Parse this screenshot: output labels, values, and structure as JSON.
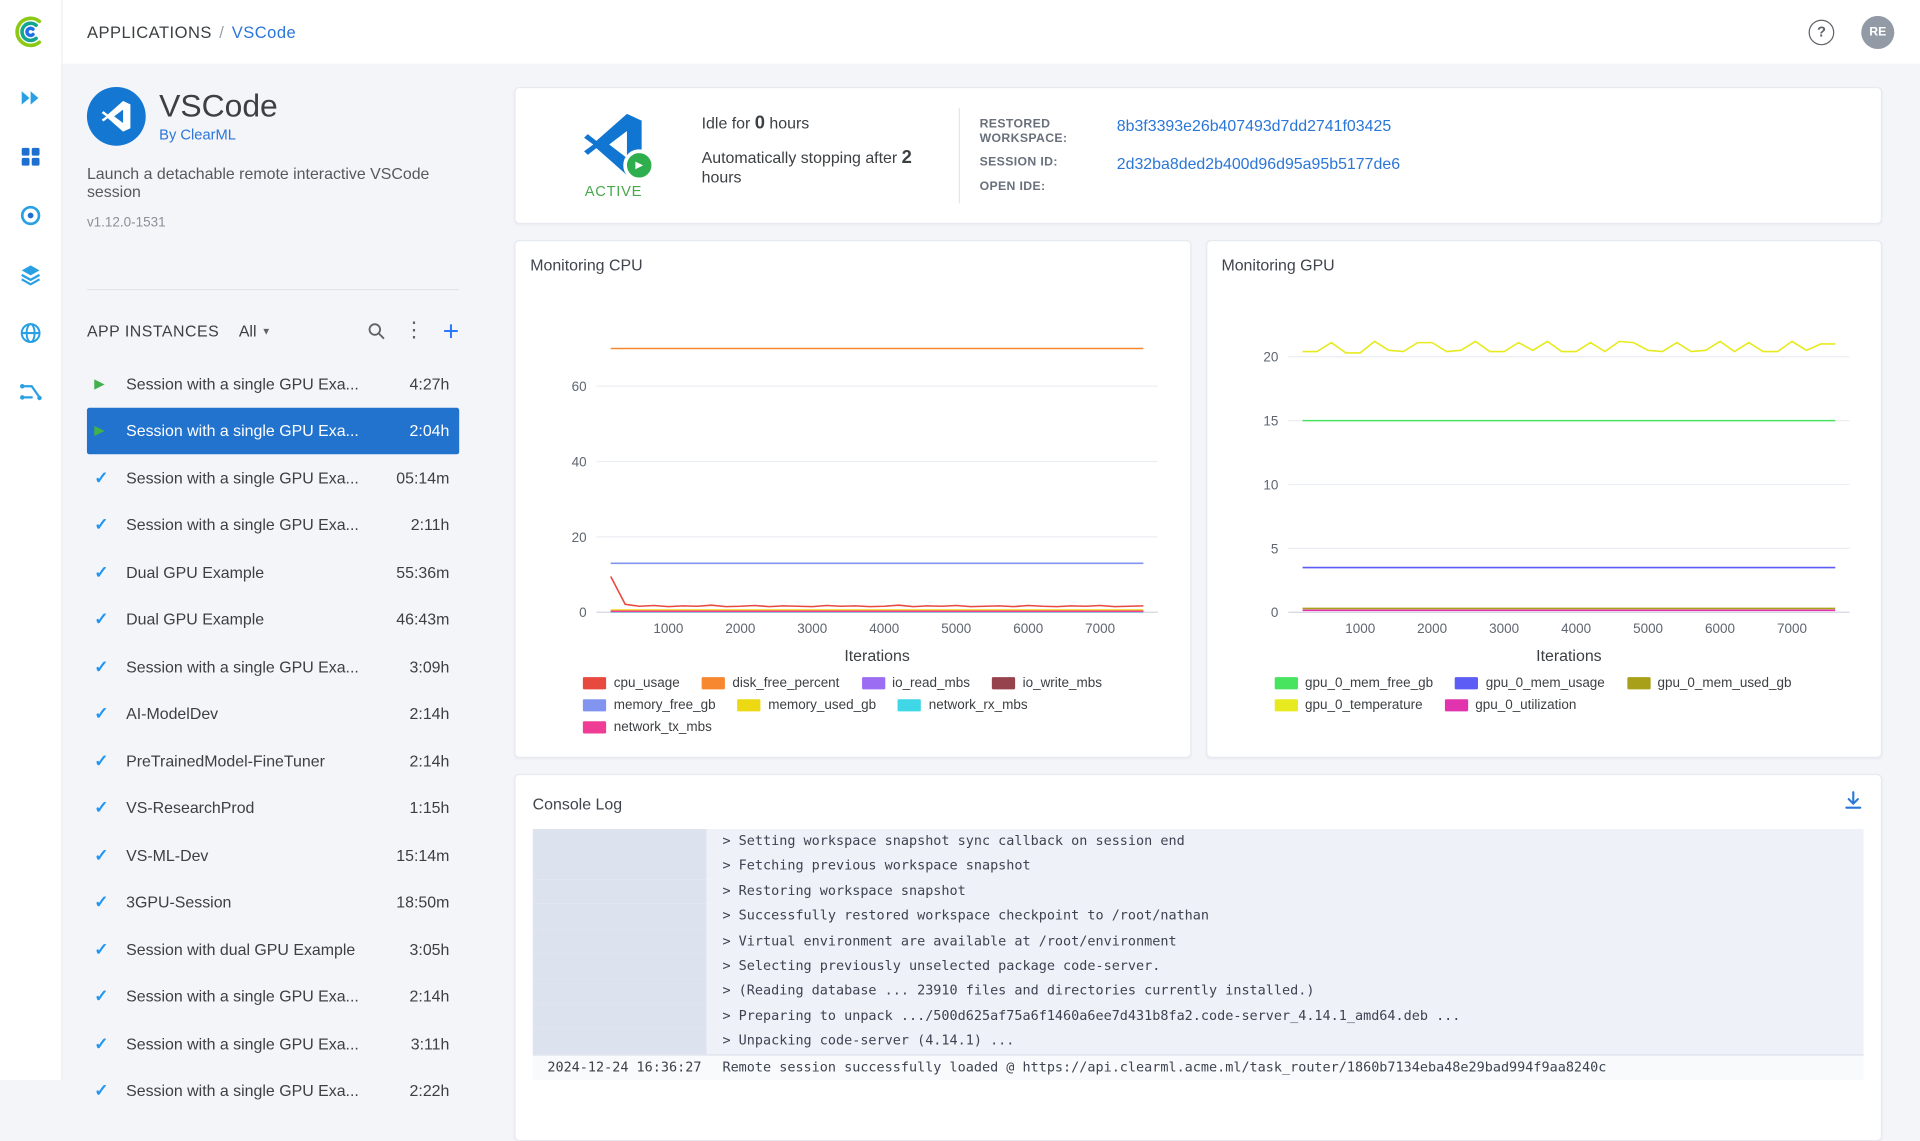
{
  "colors": {
    "link_blue": "#2a76d9",
    "selected_row_blue": "#2173ce",
    "active_green": "#49a84c",
    "check_blue": "#2196f3",
    "play_green": "#43b14b"
  },
  "topbar": {
    "breadcrumb": {
      "section": "APPLICATIONS",
      "separator": "/",
      "current": "VSCode"
    },
    "help_glyph": "?",
    "avatar_initials": "RE"
  },
  "rail": {
    "items": [
      "workers-queues",
      "dashboard",
      "applications",
      "datasets",
      "reports",
      "pipelines"
    ]
  },
  "app_panel": {
    "title": "VSCode",
    "byline": "By ClearML",
    "description": "Launch a detachable remote interactive VSCode session",
    "version": "v1.12.0-1531",
    "instances": {
      "header": "APP INSTANCES",
      "filter": "All",
      "rows": [
        {
          "status": "running",
          "name": "Session with a single GPU Exa...",
          "duration": "4:27h",
          "selected": false
        },
        {
          "status": "running",
          "name": "Session with a single GPU Exa...",
          "duration": "2:04h",
          "selected": true
        },
        {
          "status": "completed",
          "name": "Session with a single GPU Exa...",
          "duration": "05:14m",
          "selected": false
        },
        {
          "status": "completed",
          "name": "Session with a single GPU Exa...",
          "duration": "2:11h",
          "selected": false
        },
        {
          "status": "completed",
          "name": "Dual GPU Example",
          "duration": "55:36m",
          "selected": false
        },
        {
          "status": "completed",
          "name": "Dual GPU Example",
          "duration": "46:43m",
          "selected": false
        },
        {
          "status": "completed",
          "name": "Session with a single GPU Exa...",
          "duration": "3:09h",
          "selected": false
        },
        {
          "status": "completed",
          "name": "AI-ModelDev",
          "duration": "2:14h",
          "selected": false
        },
        {
          "status": "completed",
          "name": "PreTrainedModel-FineTuner",
          "duration": "2:14h",
          "selected": false
        },
        {
          "status": "completed",
          "name": "VS-ResearchProd",
          "duration": "1:15h",
          "selected": false
        },
        {
          "status": "completed",
          "name": "VS-ML-Dev",
          "duration": "15:14m",
          "selected": false
        },
        {
          "status": "completed",
          "name": "3GPU-Session",
          "duration": "18:50m",
          "selected": false
        },
        {
          "status": "completed",
          "name": "Session with dual GPU Example",
          "duration": "3:05h",
          "selected": false
        },
        {
          "status": "completed",
          "name": "Session with a single GPU Exa...",
          "duration": "2:14h",
          "selected": false
        },
        {
          "status": "completed",
          "name": "Session with a single GPU Exa...",
          "duration": "3:11h",
          "selected": false
        },
        {
          "status": "completed",
          "name": "Session with a single GPU Exa...",
          "duration": "2:22h",
          "selected": false
        }
      ]
    }
  },
  "status_card": {
    "status_label": "ACTIVE",
    "idle": {
      "prefix": "Idle for",
      "value": "0",
      "suffix": "hours"
    },
    "autostop": {
      "prefix": "Automatically stopping after",
      "value": "2",
      "suffix": "hours"
    },
    "fields": [
      {
        "label": "RESTORED WORKSPACE:",
        "value": "8b3f3393e26b407493d7dd2741f03425"
      },
      {
        "label": "SESSION ID:",
        "value": "2d32ba8ded2b400d96d95a95b5177de6"
      },
      {
        "label": "OPEN IDE:",
        "value": ""
      }
    ]
  },
  "chart_data": [
    {
      "type": "line",
      "title": "Monitoring CPU",
      "xlabel": "Iterations",
      "ylabel": "",
      "xlim": [
        0,
        7800
      ],
      "ylim": [
        0,
        78
      ],
      "xticks": [
        1000,
        2000,
        3000,
        4000,
        5000,
        6000,
        7000
      ],
      "yticks": [
        0,
        20,
        40,
        60
      ],
      "grid": true,
      "legend_position": "bottom",
      "x": [
        200,
        400,
        600,
        800,
        1000,
        1200,
        1400,
        1600,
        1800,
        2000,
        2200,
        2400,
        2600,
        2800,
        3000,
        3200,
        3400,
        3600,
        3800,
        4000,
        4200,
        4400,
        4600,
        4800,
        5000,
        5200,
        5400,
        5600,
        5800,
        6000,
        6200,
        6400,
        6600,
        6800,
        7000,
        7200,
        7400,
        7600
      ],
      "series": [
        {
          "name": "cpu_usage",
          "color": "#e8493e",
          "values": [
            9.5,
            2.1,
            1.6,
            1.8,
            1.5,
            1.7,
            1.6,
            1.9,
            1.5,
            1.6,
            1.8,
            1.5,
            1.7,
            1.6,
            1.5,
            1.8,
            1.6,
            1.7,
            1.5,
            1.6,
            1.9,
            1.5,
            1.7,
            1.6,
            1.8,
            1.5,
            1.6,
            1.7,
            1.5,
            1.8,
            1.6,
            1.5,
            1.7,
            1.6,
            1.8,
            1.5,
            1.6,
            1.7
          ]
        },
        {
          "name": "disk_free_percent",
          "color": "#f8882f",
          "values": 70
        },
        {
          "name": "io_read_mbs",
          "color": "#9b6df3",
          "values": 0.15
        },
        {
          "name": "io_write_mbs",
          "color": "#97434d",
          "values": 0.35
        },
        {
          "name": "memory_free_gb",
          "color": "#8094f0",
          "values": 13
        },
        {
          "name": "memory_used_gb",
          "color": "#ecd913",
          "values": 0.6
        },
        {
          "name": "network_rx_mbs",
          "color": "#3fd6e6",
          "values": 0.1
        },
        {
          "name": "network_tx_mbs",
          "color": "#ef3d96",
          "values": 0.25
        }
      ]
    },
    {
      "type": "line",
      "title": "Monitoring GPU",
      "xlabel": "Iterations",
      "ylabel": "",
      "xlim": [
        0,
        7800
      ],
      "ylim": [
        0,
        23
      ],
      "xticks": [
        1000,
        2000,
        3000,
        4000,
        5000,
        6000,
        7000
      ],
      "yticks": [
        0,
        5,
        10,
        15,
        20
      ],
      "grid": true,
      "legend_position": "bottom",
      "x": [
        200,
        400,
        600,
        800,
        1000,
        1200,
        1400,
        1600,
        1800,
        2000,
        2200,
        2400,
        2600,
        2800,
        3000,
        3200,
        3400,
        3600,
        3800,
        4000,
        4200,
        4400,
        4600,
        4800,
        5000,
        5200,
        5400,
        5600,
        5800,
        6000,
        6200,
        6400,
        6600,
        6800,
        7000,
        7200,
        7400,
        7600
      ],
      "series": [
        {
          "name": "gpu_0_mem_free_gb",
          "color": "#49e45f",
          "values": 15
        },
        {
          "name": "gpu_0_mem_usage",
          "color": "#5d5df5",
          "values": 3.5
        },
        {
          "name": "gpu_0_mem_used_gb",
          "color": "#a8a018",
          "values": 0.3
        },
        {
          "name": "gpu_0_temperature",
          "color": "#e7ea1f",
          "values": [
            20.4,
            20.4,
            21.1,
            20.3,
            20.3,
            21.2,
            20.5,
            20.4,
            21.1,
            21.1,
            20.4,
            20.5,
            21.2,
            20.4,
            20.4,
            21.1,
            20.5,
            21.2,
            20.4,
            20.4,
            21.1,
            20.4,
            21.2,
            21.1,
            20.5,
            20.4,
            21.1,
            20.4,
            20.5,
            21.2,
            20.4,
            21.1,
            20.4,
            20.4,
            21.2,
            20.5,
            21.0,
            21.0
          ]
        },
        {
          "name": "gpu_0_utilization",
          "color": "#e233ae",
          "values": 0.15
        }
      ]
    }
  ],
  "console": {
    "title": "Console Log",
    "lines": [
      "> Setting workspace snapshot sync callback on session end",
      "> Fetching previous workspace snapshot",
      "> Restoring workspace snapshot",
      "> Successfully restored workspace checkpoint to /root/nathan",
      "> Virtual environment are available at /root/environment",
      "> Selecting previously unselected package code-server.",
      "> (Reading database ... 23910 files and directories currently installed.)",
      "> Preparing to unpack .../500d625af75a6f1460a6ee7d431b8fa2.code-server_4.14.1_amd64.deb ...",
      "> Unpacking code-server (4.14.1) ..."
    ],
    "final": {
      "time": "2024-12-24 16:36:27",
      "text": "Remote session successfully loaded @ https://api.clearml.acme.ml/task_router/1860b7134eba48e29bad994f9aa8240c"
    }
  }
}
